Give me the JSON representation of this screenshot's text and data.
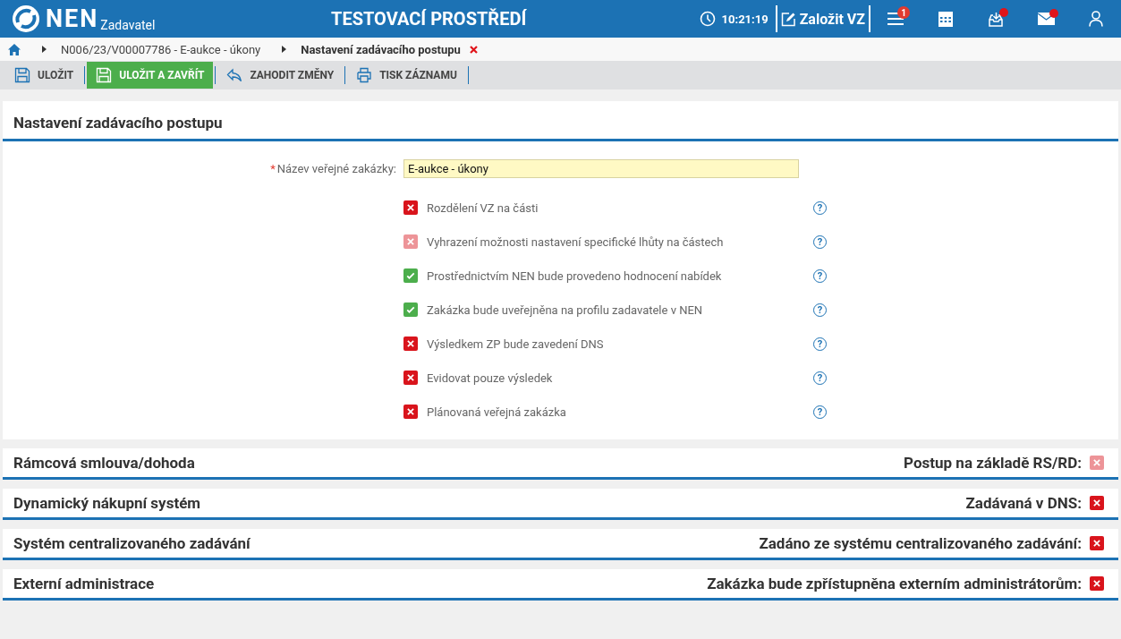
{
  "header": {
    "logo": "NEN",
    "logo_sub": "Zadavatel",
    "environment": "TESTOVACÍ PROSTŘEDÍ",
    "time": "10:21:19",
    "create_button": "Založit VZ",
    "menu_badge": "1",
    "inbox_dot": true,
    "mail_dot": true
  },
  "breadcrumb": {
    "items": [
      "N006/23/V00007786 - E-aukce - úkony",
      "Nastavení zadávacího postupu"
    ]
  },
  "toolbar": [
    {
      "label": "ULOŽIT",
      "kind": "save",
      "primary": false
    },
    {
      "label": "ULOŽIT A ZAVŘÍT",
      "kind": "save",
      "primary": true
    },
    {
      "label": "ZAHODIT ZMĚNY",
      "kind": "discard",
      "primary": false
    },
    {
      "label": "TISK ZÁZNAMU",
      "kind": "print",
      "primary": false
    }
  ],
  "panel": {
    "title": "Nastavení zadávacího postupu",
    "field": {
      "label": "Název veřejné zakázky:",
      "required_mark": "*",
      "value": "E-aukce - úkony"
    },
    "options": [
      {
        "label": "Rozdělení VZ na části",
        "yes": false,
        "disabled": false,
        "help": "?"
      },
      {
        "label": "Vyhrazení možnosti nastavení specifické lhůty na částech",
        "yes": false,
        "disabled": true,
        "help": "?"
      },
      {
        "label": "Prostřednictvím NEN bude provedeno hodnocení nabídek",
        "yes": true,
        "disabled": false,
        "help": "?"
      },
      {
        "label": "Zakázka bude uveřejněna na profilu zadavatele v NEN",
        "yes": true,
        "disabled": false,
        "help": "?"
      },
      {
        "label": "Výsledkem ZP bude zavedení DNS",
        "yes": false,
        "disabled": false,
        "help": "?"
      },
      {
        "label": "Evidovat pouze výsledek",
        "yes": false,
        "disabled": false,
        "help": "?"
      },
      {
        "label": "Plánovaná veřejná zakázka",
        "yes": false,
        "disabled": false,
        "help": "?"
      }
    ]
  },
  "sections": [
    {
      "title": "Rámcová smlouva/dohoda",
      "option": "Postup na základě RS/RD:",
      "yes": false,
      "disabled": true
    },
    {
      "title": "Dynamický nákupní systém",
      "option": "Zadávaná v DNS:",
      "yes": false,
      "disabled": false
    },
    {
      "title": "Systém centralizovaného zadávání",
      "option": "Zadáno ze systému centralizovaného zadávání:",
      "yes": false,
      "disabled": false
    },
    {
      "title": "Externí administrace",
      "option": "Zakázka bude zpřístupněna externím administrátorům:",
      "yes": false,
      "disabled": false
    }
  ]
}
